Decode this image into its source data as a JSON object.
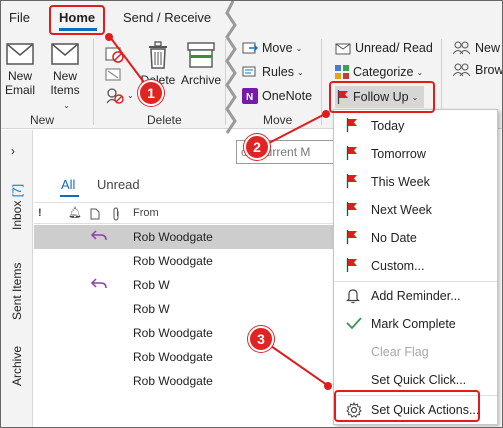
{
  "menubar": {
    "tabs": [
      "File",
      "Home",
      "Send / Receive"
    ]
  },
  "ribbon": {
    "new_email": "New Email",
    "new_items": "New Items",
    "group_new": "New",
    "delete": "Delete",
    "archive": "Archive",
    "group_delete": "Delete",
    "move": "Move",
    "rules": "Rules",
    "onenote": "OneNote",
    "group_move": "Move",
    "unread_read": "Unread/ Read",
    "categorize": "Categorize",
    "follow_up": "Follow Up",
    "new_group": "New G",
    "browse": "Brows"
  },
  "folders": {
    "inbox_label": "Inbox",
    "inbox_count": "[7]",
    "sent": "Sent Items",
    "archive": "Archive"
  },
  "messages": {
    "search_placeholder": "ch Current M",
    "filter_all": "All",
    "filter_unread": "Unread",
    "col_from": "From",
    "col_importance": "!",
    "rows": [
      {
        "from": "Rob Woodgate",
        "replied": true,
        "selected": true
      },
      {
        "from": "Rob Woodgate",
        "replied": false,
        "selected": false
      },
      {
        "from": "Rob W",
        "replied": true,
        "selected": false
      },
      {
        "from": "Rob W",
        "replied": false,
        "selected": false
      },
      {
        "from": "Rob Woodgate",
        "replied": false,
        "selected": false
      },
      {
        "from": "Rob Woodgate",
        "replied": false,
        "selected": false
      },
      {
        "from": "Rob Woodgate",
        "replied": false,
        "selected": false
      }
    ]
  },
  "followup_menu": {
    "items": [
      {
        "label": "Today",
        "icon": "red-flag-icon"
      },
      {
        "label": "Tomorrow",
        "icon": "red-flag-icon"
      },
      {
        "label": "This Week",
        "icon": "red-flag-icon"
      },
      {
        "label": "Next Week",
        "icon": "red-flag-icon"
      },
      {
        "label": "No Date",
        "icon": "red-flag-icon"
      },
      {
        "label": "Custom...",
        "icon": "red-flag-icon"
      },
      {
        "label": "Add Reminder...",
        "icon": "bell-icon"
      },
      {
        "label": "Mark Complete",
        "icon": "checkmark-icon"
      },
      {
        "label": "Clear Flag",
        "icon": "none",
        "disabled": true
      },
      {
        "label": "Set Quick Click...",
        "icon": "none"
      },
      {
        "label": "Set Quick Actions...",
        "icon": "gear-icon"
      }
    ]
  },
  "annotations": {
    "badges": [
      "1",
      "2",
      "3"
    ],
    "accent": "#e21c1c"
  },
  "colors": {
    "accent_blue": "#0f6cbd",
    "flag_red": "#e21c1c"
  }
}
